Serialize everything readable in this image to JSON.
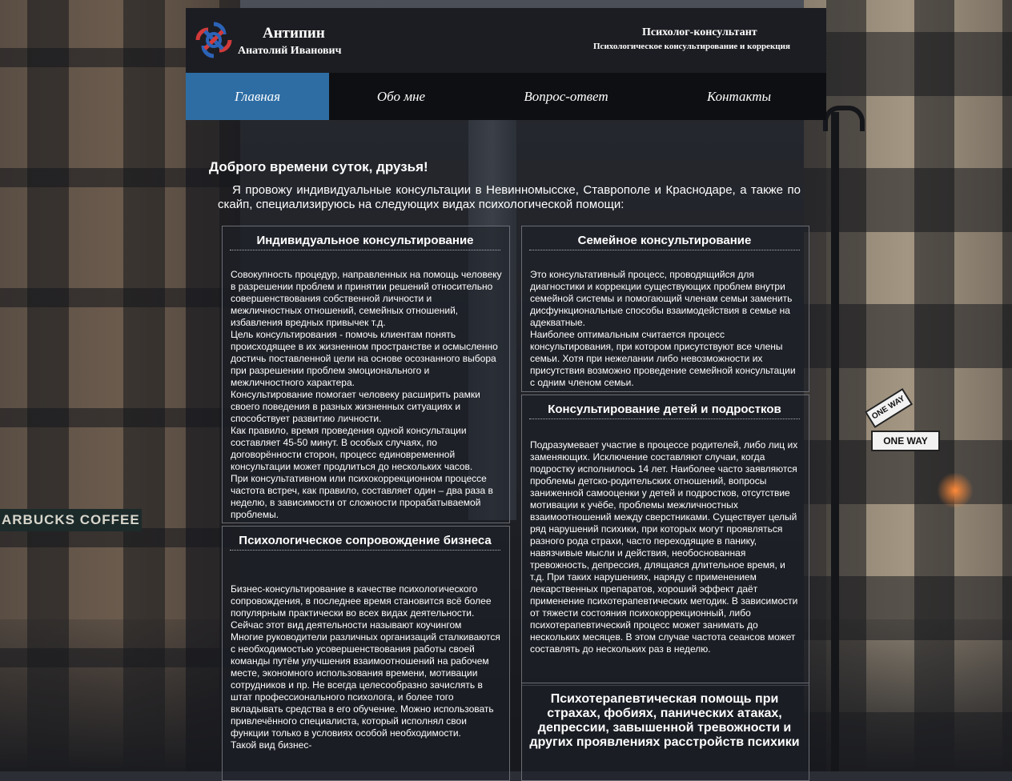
{
  "header": {
    "name_last": "Антипин",
    "name_full": "Анатолий Иванович",
    "role": "Психолог-консультант",
    "subtitle": "Психологическое консультирование и коррекция"
  },
  "nav": {
    "items": [
      "Главная",
      "Обо мне",
      "Вопрос-ответ",
      "Контакты"
    ],
    "active": "Главная"
  },
  "background": {
    "store_sign": "ARBUCKS COFFEE",
    "street_sign_1": "ONE WAY",
    "street_sign_2": "ONE WAY"
  },
  "main": {
    "greeting": "Доброго времени суток, друзья!",
    "intro": "Я провожу индивидуальные консультации в Невинномысске, Ставрополе и Краснодаре, а также по скайп, специализируюсь на следующих видах психологической помощи:",
    "cards": [
      {
        "title": "Индивидуальное консультирование",
        "text": "Совокупность процедур, направленных на помощь человеку в разрешении проблем и принятии решений относительно совершенствования собственной личности и межличностных отношений, семейных отношений, избавления вредных привычек т.д.\nЦель консультирования - помочь клиентам понять происходящее в их жизненном пространстве и осмысленно достичь поставленной цели на основе осознанного выбора при разрешении проблем эмоционального и межличностного характера.\nКонсультирование помогает человеку расширить рамки своего поведения в разных жизненных ситуациях и способствует развитию личности.\nКак правило, время проведения одной консультации составляет 45-50 минут. В особых случаях, по договорённости сторон, процесс единовременной консультации может продлиться до нескольких часов.\nПри консультативном или психокоррекционном процессе частота встреч, как правило, составляет один – два раза в неделю, в зависимости от сложности прорабатываемой проблемы."
      },
      {
        "title": "Психологическое сопровождение бизнеса",
        "text": "Бизнес-консультирование в качестве психологического сопровождения, в последнее время становится всё более популярным практически во всех видах деятельности. Сейчас этот вид деятельности называют коучингом\nМногие руководители различных организаций сталкиваются с необходимостью усовершенствования работы своей команды путём улучшения взаимоотношений на рабочем месте, экономного использования времени, мотивации сотрудников и пр. Не всегда целесообразно зачислять в штат профессионального психолога, и более того вкладывать средства в его обучение. Можно использовать привлечённого специалиста, который исполнял свои функции только в условиях особой необходимости.\nТакой вид бизнес-"
      },
      {
        "title": "Семейное консультирование",
        "text": "Это консультативный процесс, проводящийся для диагностики и коррекции существующих проблем внутри семейной системы и помогающий членам семьи заменить дисфункциональные способы взаимодействия в семье на адекватные.\nНаиболее оптимальным считается процесс консультирования, при котором присутствуют все члены семьи. Хотя при нежелании либо невозможности их присутствия возможно проведение семейной консультации с одним членом семьи."
      },
      {
        "title": "Консультирование детей и подростков",
        "text": "Подразумевает участие в процессе родителей, либо лиц их заменяющих. Исключение составляют случаи, когда подростку исполнилось 14 лет. Наиболее часто заявляются проблемы детско-родительских отношений, вопросы заниженной самооценки у детей и подростков, отсутствие мотивации к учёбе, проблемы межличностных взаимоотношений между сверстниками. Существует целый ряд нарушений психики, при которых могут проявляться разного рода страхи, часто переходящие в панику, навязчивые мысли и действия, необоснованная тревожность, депрессия, длящаяся длительное время, и т.д. При таких нарушениях, наряду с применением лекарственных препаратов, хороший эффект даёт применение психотерапевтических методик. В зависимости от тяжести состояния психокоррекционный, либо психотерапевтический процесс может занимать до нескольких месяцев. В этом случае частота сеансов может составлять до нескольких раз в неделю."
      },
      {
        "title": "Психотерапевтическая помощь при страхах, фобиях, панических атаках, депрессии, завышенной тревожности и других проявлениях расстройств психики",
        "text": ""
      }
    ]
  }
}
